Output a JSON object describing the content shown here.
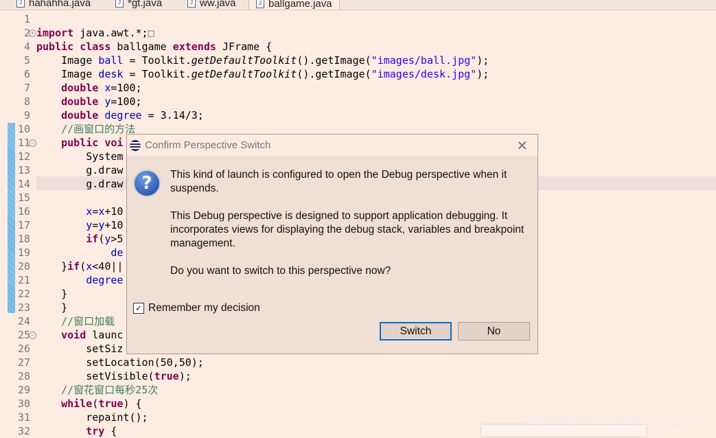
{
  "tabs": [
    {
      "label": "hahahha.java"
    },
    {
      "label": "*gt.java"
    },
    {
      "label": "ww.java"
    },
    {
      "label": "ballgame.java",
      "active": true
    }
  ],
  "code": {
    "lines": [
      {
        "n": "1",
        "t": []
      },
      {
        "n": "2",
        "t": [
          {
            "c": "k",
            "t": "import"
          },
          {
            "c": "",
            "t": " java.awt.*;"
          },
          {
            "c": "",
            "t": "⬚"
          }
        ]
      },
      {
        "n": "4",
        "t": [
          {
            "c": "k",
            "t": "public class"
          },
          {
            "c": "",
            "t": " ballgame "
          },
          {
            "c": "k",
            "t": "extends"
          },
          {
            "c": "",
            "t": " JFrame {"
          }
        ]
      },
      {
        "n": "5",
        "t": [
          {
            "c": "",
            "t": "    Image "
          },
          {
            "c": "f",
            "t": "ball"
          },
          {
            "c": "",
            "t": " = Toolkit."
          },
          {
            "c": "i",
            "t": "getDefaultToolkit"
          },
          {
            "c": "",
            "t": "().getImage("
          },
          {
            "c": "s",
            "t": "\"images/ball.jpg\""
          },
          {
            "c": "",
            "t": ");"
          }
        ]
      },
      {
        "n": "6",
        "t": [
          {
            "c": "",
            "t": "    Image "
          },
          {
            "c": "f",
            "t": "desk"
          },
          {
            "c": "",
            "t": " = Toolkit."
          },
          {
            "c": "i",
            "t": "getDefaultToolkit"
          },
          {
            "c": "",
            "t": "().getImage("
          },
          {
            "c": "s",
            "t": "\"images/desk.jpg\""
          },
          {
            "c": "",
            "t": ");"
          }
        ]
      },
      {
        "n": "7",
        "t": [
          {
            "c": "k",
            "t": "    double"
          },
          {
            "c": "f",
            "t": " x"
          },
          {
            "c": "",
            "t": "=100;"
          }
        ]
      },
      {
        "n": "8",
        "t": [
          {
            "c": "k",
            "t": "    double"
          },
          {
            "c": "f",
            "t": " y"
          },
          {
            "c": "",
            "t": "=100;"
          }
        ]
      },
      {
        "n": "9",
        "t": [
          {
            "c": "k",
            "t": "    double"
          },
          {
            "c": "f",
            "t": " degree"
          },
          {
            "c": "",
            "t": " = 3.14/3;"
          }
        ]
      },
      {
        "n": "10",
        "t": [
          {
            "c": "c",
            "t": "    //画窗口的方法"
          }
        ]
      },
      {
        "n": "11",
        "t": [
          {
            "c": "k",
            "t": "    public voi"
          }
        ]
      },
      {
        "n": "12",
        "t": [
          {
            "c": "",
            "t": "        System"
          }
        ]
      },
      {
        "n": "13",
        "t": [
          {
            "c": "",
            "t": "        g.draw"
          }
        ]
      },
      {
        "n": "14",
        "t": [
          {
            "c": "",
            "t": "        g.draw"
          }
        ]
      },
      {
        "n": "15",
        "t": []
      },
      {
        "n": "16",
        "t": [
          {
            "c": "f",
            "t": "        x"
          },
          {
            "c": "",
            "t": "="
          },
          {
            "c": "f",
            "t": "x"
          },
          {
            "c": "",
            "t": "+10"
          }
        ]
      },
      {
        "n": "17",
        "t": [
          {
            "c": "f",
            "t": "        y"
          },
          {
            "c": "",
            "t": "="
          },
          {
            "c": "f",
            "t": "y"
          },
          {
            "c": "",
            "t": "+10"
          }
        ]
      },
      {
        "n": "18",
        "t": [
          {
            "c": "k",
            "t": "        if"
          },
          {
            "c": "",
            "t": "("
          },
          {
            "c": "f",
            "t": "y"
          },
          {
            "c": "",
            "t": ">5"
          }
        ]
      },
      {
        "n": "19",
        "t": [
          {
            "c": "f",
            "t": "            de"
          }
        ]
      },
      {
        "n": "20",
        "t": [
          {
            "c": "",
            "t": "    }"
          },
          {
            "c": "k",
            "t": "if"
          },
          {
            "c": "",
            "t": "("
          },
          {
            "c": "f",
            "t": "x"
          },
          {
            "c": "",
            "t": "<40||"
          }
        ]
      },
      {
        "n": "21",
        "t": [
          {
            "c": "f",
            "t": "        degree"
          }
        ]
      },
      {
        "n": "22",
        "t": [
          {
            "c": "",
            "t": "    }"
          }
        ]
      },
      {
        "n": "23",
        "t": [
          {
            "c": "",
            "t": "    }"
          }
        ]
      },
      {
        "n": "24",
        "t": [
          {
            "c": "c",
            "t": "    //窗口加载"
          }
        ]
      },
      {
        "n": "25",
        "t": [
          {
            "c": "k",
            "t": "    void"
          },
          {
            "c": "",
            "t": " launc"
          }
        ]
      },
      {
        "n": "26",
        "t": [
          {
            "c": "",
            "t": "        setSiz"
          }
        ]
      },
      {
        "n": "27",
        "t": [
          {
            "c": "",
            "t": "        setLocation(50,50);"
          }
        ]
      },
      {
        "n": "28",
        "t": [
          {
            "c": "",
            "t": "        setVisible("
          },
          {
            "c": "k",
            "t": "true"
          },
          {
            "c": "",
            "t": ");"
          }
        ]
      },
      {
        "n": "29",
        "t": [
          {
            "c": "c",
            "t": "    //窗花窗口每秒25次"
          }
        ]
      },
      {
        "n": "30",
        "t": [
          {
            "c": "k",
            "t": "    while"
          },
          {
            "c": "",
            "t": "("
          },
          {
            "c": "k",
            "t": "true"
          },
          {
            "c": "",
            "t": ") {"
          }
        ]
      },
      {
        "n": "31",
        "t": [
          {
            "c": "",
            "t": "        repaint();"
          }
        ]
      },
      {
        "n": "32",
        "t": [
          {
            "c": "k",
            "t": "        try"
          },
          {
            "c": "",
            "t": " {"
          }
        ]
      }
    ]
  },
  "dialog": {
    "title": "Confirm Perspective Switch",
    "msg1": "This kind of launch is configured to open the Debug perspective when it suspends.",
    "msg2": "This Debug perspective is designed to support application debugging. It incorporates views for displaying the debug stack, variables and breakpoint management.",
    "msg3": "Do you want to switch to this perspective now?",
    "remember_label": "Remember my decision",
    "remember_checked": true,
    "switch_label": "Switch",
    "no_label": "No"
  },
  "watermark": "https://blog.csdn.net/weixin_45629531",
  "colors": {
    "keyword": "#7f0055",
    "field": "#0000c0",
    "string": "#2a00ff",
    "comment": "#3f7f5f",
    "editor_bg": "#fdece1",
    "default_button_border": "#0a6fc2"
  }
}
